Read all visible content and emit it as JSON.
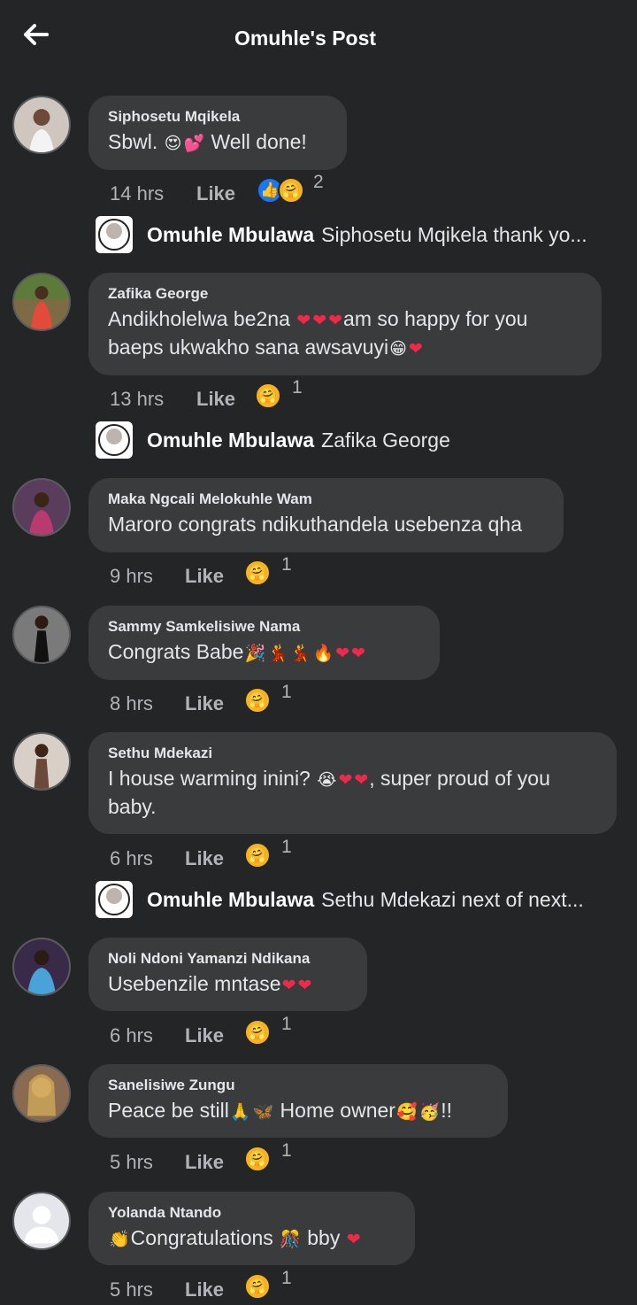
{
  "header": {
    "title": "Omuhle's Post",
    "back_icon": "arrow-left-icon"
  },
  "like_label": "Like",
  "comments": [
    {
      "name": "Siphosetu Mqikela",
      "text": "Sbwl. ",
      "emoji": [
        "😍",
        "💕"
      ],
      "text_after": " Well done!",
      "time": "14 hrs",
      "reactions": [
        "like",
        "care"
      ],
      "count": "2"
    },
    {
      "name": "Zafika George",
      "text": "Andikholelwa be2na ",
      "emoji": [
        "❤",
        "❤",
        "❤"
      ],
      "text_after": "am so happy for you baeps ukwakho sana awsavuyi",
      "emoji_after": [
        "😁",
        "❤"
      ],
      "time": "13 hrs",
      "reactions": [
        "care"
      ],
      "count": "1"
    },
    {
      "name": "Maka Ngcali Melokuhle Wam",
      "text": "Maroro congrats ndikuthandela usebenza qha",
      "time": "9 hrs",
      "reactions": [
        "care"
      ],
      "count": "1"
    },
    {
      "name": "Sammy Samkelisiwe Nama",
      "text": "Congrats Babe",
      "emoji": [
        "🎉",
        "💃",
        "💃",
        "🔥",
        "❤",
        "❤"
      ],
      "time": "8 hrs",
      "reactions": [
        "care"
      ],
      "count": "1"
    },
    {
      "name": "Sethu Mdekazi",
      "text": "I house warming inini? ",
      "emoji": [
        "😭",
        "❤",
        "❤"
      ],
      "text_after": ", super proud of you baby.",
      "time": "6 hrs",
      "reactions": [
        "care"
      ],
      "count": "1"
    },
    {
      "name": "Noli Ndoni Yamanzi Ndikana",
      "text": "Usebenzile mntase",
      "emoji": [
        "❤",
        "❤"
      ],
      "time": "6 hrs",
      "reactions": [
        "care"
      ],
      "count": "1"
    },
    {
      "name": "Sanelisiwe Zungu",
      "text": "Peace be still",
      "emoji": [
        "🙏",
        "🦋"
      ],
      "text_after": " Home owner",
      "emoji_after": [
        "🥰",
        "🥳"
      ],
      "text_end": "!!",
      "time": "5 hrs",
      "reactions": [
        "care"
      ],
      "count": "1"
    },
    {
      "name": "Yolanda Ntando",
      "text": "",
      "emoji": [
        "👏"
      ],
      "text_after": "Congratulations ",
      "emoji_after": [
        "🎊"
      ],
      "text_end": " bby ",
      "emoji_end": [
        "❤"
      ],
      "time": "5 hrs",
      "reactions": [
        "care"
      ],
      "count": "1"
    }
  ],
  "replies": [
    {
      "author": "Omuhle  Mbulawa",
      "text": "Siphosetu Mqikela thank yo..."
    },
    {
      "author": "Omuhle  Mbulawa",
      "text": "Zafika George"
    },
    {
      "author": "Omuhle  Mbulawa",
      "text": "Sethu Mdekazi next of next..."
    }
  ],
  "colors": {
    "background": "#242526",
    "bubble": "#3a3b3c",
    "like_blue": "#1877f2",
    "care_yellow": "#f7b125",
    "heart": "#f02849"
  }
}
